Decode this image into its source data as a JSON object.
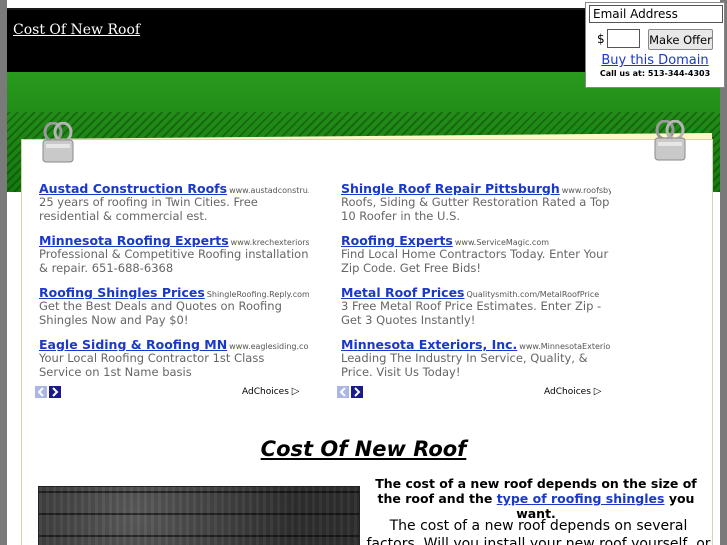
{
  "header": {
    "site_title": "Cost Of New Roof"
  },
  "offer": {
    "email_value": "Email Address",
    "dollar_sign": "$",
    "price_value": "",
    "button_label": "Make Offer",
    "buy_link": "Buy this Domain",
    "phone": "Call us at: 513-344-4303"
  },
  "ads_left": [
    {
      "title": "Austad Construction Roofs",
      "url": "www.austadconstru...",
      "desc": "25 years of roofing in Twin Cities. Free residential & commercial est."
    },
    {
      "title": "Minnesota Roofing Experts",
      "url": "www.krechexteriors...",
      "desc": "Professional & Competitive Roofing installation & repair. 651-688-6368"
    },
    {
      "title": "Roofing Shingles Prices",
      "url": "ShingleRoofing.Reply.com",
      "desc": "Get the Best Deals and Quotes on Roofing Shingles Now and Pay $0!"
    },
    {
      "title": "Eagle Siding & Roofing MN",
      "url": "www.eaglesiding.com",
      "desc": "Your Local Roofing Contractor 1st Class Service on 1st Name basis"
    }
  ],
  "ads_right": [
    {
      "title": "Shingle Roof Repair Pittsburgh",
      "url": "www.roofsby...",
      "desc": "Roofs, Siding & Gutter Restoration Rated a Top 10 Roofer in the U.S."
    },
    {
      "title": "Roofing Experts",
      "url": "www.ServiceMagic.com",
      "desc": "Find Local Home Contractors Today. Enter Your Zip Code. Get Free Bids!"
    },
    {
      "title": "Metal Roof Prices",
      "url": "Qualitysmith.com/MetalRoofPrice",
      "desc": "3 Free Metal Roof Price Estimates. Enter Zip - Get 3 Quotes Instantly!"
    },
    {
      "title": "Minnesota Exteriors, Inc.",
      "url": "www.MinnesotaExterio...",
      "desc": "Leading The Industry In Service, Quality, & Price. Visit Us Today!"
    }
  ],
  "adchoices_label": "AdChoices",
  "main": {
    "heading": "Cost Of New Roof",
    "intro_before": "The cost of a new roof depends on the size of the roof and the ",
    "intro_link": "type of roofing shingles",
    "intro_after": " you want.",
    "paragraph": "The cost of a new roof depends on several factors. Will you install your new roof yourself, or will you"
  },
  "icons": {
    "clip": "binder-clip-icon",
    "prev": "arrow-left-icon",
    "next": "arrow-right-icon",
    "adchoices": "adchoices-triangle-icon"
  },
  "colors": {
    "link": "#1a38c9",
    "green": "#1f8a16",
    "header_bg": "#000000"
  }
}
